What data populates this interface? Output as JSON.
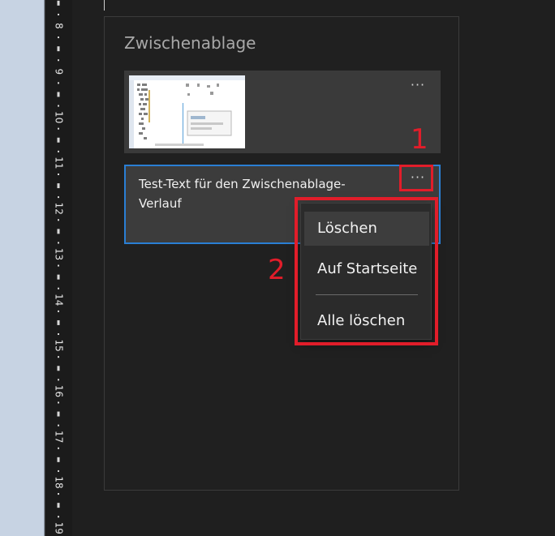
{
  "ruler": {
    "labels": [
      "8",
      "9",
      "10",
      "11",
      "12",
      "13",
      "14",
      "15",
      "16",
      "17",
      "18",
      "19"
    ]
  },
  "clipboard": {
    "title": "Zwischenablage",
    "items": [
      {
        "type": "image",
        "more_label": "···"
      },
      {
        "type": "text",
        "text": "Test-Text für den Zwischenablage-Verlauf",
        "more_label": "···"
      }
    ]
  },
  "context_menu": {
    "items": [
      {
        "label": "Löschen"
      },
      {
        "label": "Auf Startseite"
      },
      {
        "label": "Alle löschen"
      }
    ]
  },
  "annotations": {
    "marker_1": "1",
    "marker_2": "2",
    "color": "#e11d2a"
  },
  "colors": {
    "accent": "#2a7fd4",
    "panel_bg": "#202020",
    "item_bg": "#3a3a3a",
    "menu_bg": "#2b2b2b"
  }
}
